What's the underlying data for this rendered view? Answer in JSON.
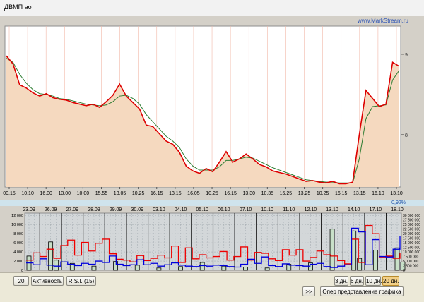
{
  "window": {
    "title": "ДВМП ао"
  },
  "main_chart": {
    "watermark": "www.MarkStream.ru",
    "y_ticks": [
      {
        "value": 8,
        "label": "8"
      },
      {
        "value": 9,
        "label": "9"
      }
    ],
    "x_labels": [
      "00.15",
      "10.10",
      "16.00",
      "13.00",
      "10.00",
      "15.55",
      "13.05",
      "10.25",
      "16.15",
      "13.15",
      "16.05",
      "10.25",
      "16.15",
      "13.30",
      "10.35",
      "16.25",
      "13.25",
      "10.25",
      "16.15",
      "13.15",
      "16.10",
      "13.10"
    ],
    "colors": {
      "price": "#dd0000",
      "ma": "#2e7d32",
      "fill": "#f5d9bf",
      "background": "#ffffff"
    },
    "price": [
      8.98,
      8.88,
      8.62,
      8.58,
      8.52,
      8.48,
      8.51,
      8.46,
      8.44,
      8.43,
      8.4,
      8.38,
      8.36,
      8.38,
      8.34,
      8.41,
      8.49,
      8.63,
      8.48,
      8.4,
      8.32,
      8.12,
      8.1,
      8.01,
      7.92,
      7.88,
      7.78,
      7.61,
      7.55,
      7.52,
      7.58,
      7.54,
      7.66,
      7.79,
      7.66,
      7.7,
      7.76,
      7.7,
      7.63,
      7.6,
      7.55,
      7.53,
      7.51,
      7.48,
      7.45,
      7.42,
      7.43,
      7.41,
      7.4,
      7.42,
      7.39,
      7.39,
      7.41,
      8.0,
      8.55,
      8.45,
      8.35,
      8.38,
      8.9,
      8.85
    ],
    "ma": [
      8.95,
      8.9,
      8.75,
      8.64,
      8.56,
      8.51,
      8.5,
      8.48,
      8.45,
      8.44,
      8.42,
      8.4,
      8.38,
      8.37,
      8.36,
      8.37,
      8.41,
      8.48,
      8.49,
      8.45,
      8.38,
      8.25,
      8.16,
      8.07,
      7.98,
      7.92,
      7.84,
      7.7,
      7.61,
      7.56,
      7.56,
      7.56,
      7.6,
      7.68,
      7.68,
      7.7,
      7.72,
      7.71,
      7.67,
      7.63,
      7.59,
      7.56,
      7.53,
      7.5,
      7.47,
      7.44,
      7.43,
      7.42,
      7.41,
      7.41,
      7.4,
      7.4,
      7.4,
      7.7,
      8.2,
      8.35,
      8.36,
      8.37,
      8.68,
      8.8
    ],
    "ylim": [
      7.35,
      9.35
    ]
  },
  "split_bar": {
    "value": "0,92%"
  },
  "indicator_chart": {
    "date_labels": [
      "23.09",
      "26.09",
      "27.09",
      "28.09",
      "29.09",
      "30.09",
      "03.10",
      "04.10",
      "05.10",
      "06.10",
      "07.10",
      "10.10",
      "11.10",
      "12.10",
      "13.10",
      "14.10",
      "17.10",
      "18.10"
    ],
    "y_left": [
      {
        "value": 0,
        "label": "0"
      },
      {
        "value": 2000,
        "label": "2 000"
      },
      {
        "value": 4000,
        "label": "4 000"
      },
      {
        "value": 6000,
        "label": "6 000"
      },
      {
        "value": 8000,
        "label": "8 000"
      },
      {
        "value": 10000,
        "label": "10 000"
      },
      {
        "value": 12000,
        "label": "12 000"
      }
    ],
    "y_right": [
      {
        "value": 0,
        "label": "0"
      },
      {
        "value": 2500000,
        "label": "2 500 000"
      },
      {
        "value": 5000000,
        "label": "5 000 000"
      },
      {
        "value": 7500000,
        "label": "7 500 000"
      },
      {
        "value": 10000000,
        "label": "10 000 000"
      },
      {
        "value": 12500000,
        "label": "12 500 000"
      },
      {
        "value": 15000000,
        "label": "15 000 000"
      },
      {
        "value": 17500000,
        "label": "17 500 000"
      },
      {
        "value": 20000000,
        "label": "20 000 000"
      },
      {
        "value": 22500000,
        "label": "22 500 000"
      },
      {
        "value": 25000000,
        "label": "25 000 000"
      },
      {
        "value": 27500000,
        "label": "27 500 000"
      },
      {
        "value": 30000000,
        "label": "30 000 000"
      }
    ],
    "colors": {
      "red": "#ee0000",
      "blue": "#0000dd",
      "bars_fill": "#c8e0c8",
      "bars_stroke": "#000000",
      "background": "#d3d7d9"
    },
    "red_series": [
      2200,
      3800,
      3000,
      4600,
      2600,
      5400,
      6600,
      3300,
      6100,
      4200,
      5900,
      6800,
      3600,
      2400,
      2200,
      1800,
      3200,
      2100,
      2600,
      3300,
      2700,
      5300,
      1700,
      4900,
      2500,
      3400,
      2700,
      3000,
      4100,
      2200,
      3000,
      5100,
      2200,
      3900,
      3700,
      2500,
      2100,
      4500,
      3300,
      4500,
      2000,
      2800,
      4200,
      3400,
      3100,
      2100,
      1400,
      6800,
      1700,
      9800,
      8000,
      2800,
      3100,
      2600,
      3800
    ],
    "blue_series": [
      1600,
      1200,
      2500,
      1100,
      900,
      1800,
      1300,
      1000,
      1500,
      1300,
      2000,
      1700,
      3100,
      1300,
      1000,
      1200,
      2300,
      1200,
      1500,
      900,
      1200,
      1600,
      1100,
      900,
      800,
      1000,
      900,
      1100,
      1000,
      800,
      700,
      1300,
      2400,
      1500,
      2900,
      1000,
      800,
      1400,
      1100,
      1000,
      900,
      1300,
      1500,
      800,
      600,
      900,
      1200,
      9200,
      8400,
      1200,
      6700,
      3000,
      2900,
      4600,
      7400
    ],
    "bars": [
      {
        "d": 0,
        "v": 3100
      },
      {
        "d": 1,
        "v": 6200
      },
      {
        "d": 1,
        "v": 2200
      },
      {
        "d": 2,
        "v": 1500
      },
      {
        "d": 3,
        "v": 900
      },
      {
        "d": 4,
        "v": 1900
      },
      {
        "d": 5,
        "v": 1100
      },
      {
        "d": 6,
        "v": 500
      },
      {
        "d": 7,
        "v": 800
      },
      {
        "d": 8,
        "v": 1700
      },
      {
        "d": 9,
        "v": 900
      },
      {
        "d": 10,
        "v": 700
      },
      {
        "d": 11,
        "v": 500
      },
      {
        "d": 12,
        "v": 1300
      },
      {
        "d": 13,
        "v": 1600
      },
      {
        "d": 14,
        "v": 9000
      },
      {
        "d": 15,
        "v": 8600
      },
      {
        "d": 15,
        "v": 2600
      },
      {
        "d": 16,
        "v": 4400
      },
      {
        "d": 17,
        "v": 4900
      },
      {
        "d": 17,
        "v": 1800
      }
    ],
    "ylim_left": [
      0,
      12500
    ],
    "ylim_right": [
      0,
      31250000
    ]
  },
  "controls": {
    "period_value": "20",
    "activity_label": "Активность",
    "rsi_label": "R.S.I.  (15)",
    "scroll_label": ">>",
    "ranges": [
      "3 дн.",
      "6 дн.",
      "10 дн.",
      "20 дн."
    ],
    "active_range": "20 дн.",
    "view_button_label": "Опер представление графика"
  }
}
